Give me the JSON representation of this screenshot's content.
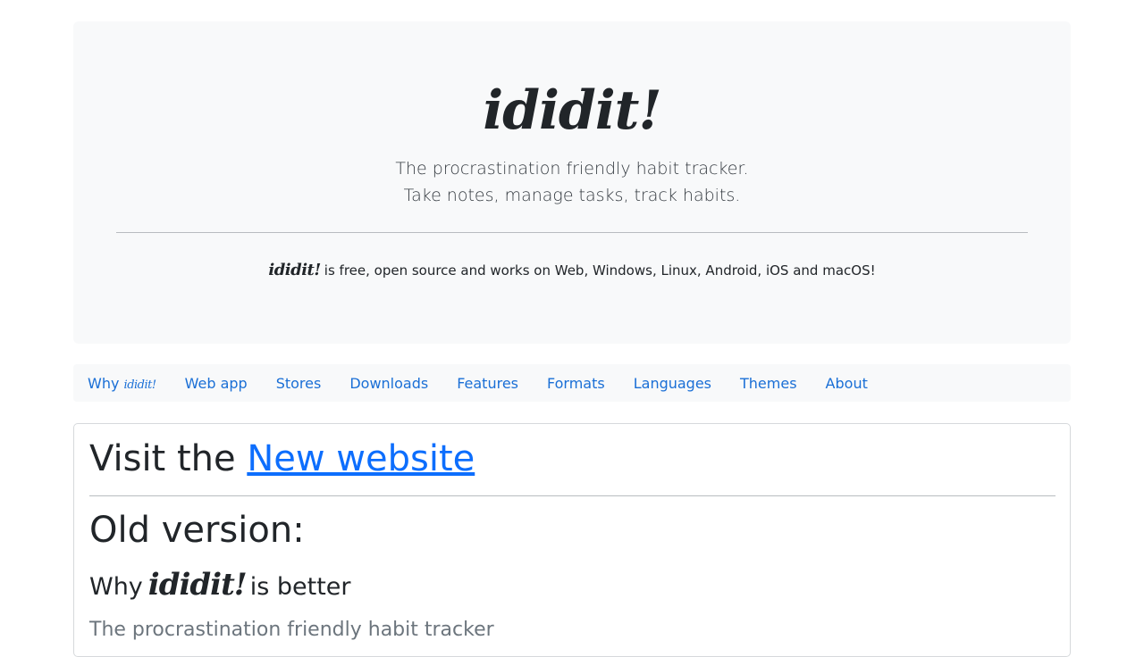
{
  "header": {
    "logo": "ididit!",
    "tagline_1": "The procrastination friendly habit tracker.",
    "tagline_2": "Take notes, manage tasks, track habits.",
    "free_logo": "ididit!",
    "free_text": "is free, open source and works on Web, Windows, Linux, Android, iOS and macOS!"
  },
  "nav": {
    "why_prefix": "Why",
    "why_logo": "ididit!",
    "items": [
      "Web app",
      "Stores",
      "Downloads",
      "Features",
      "Formats",
      "Languages",
      "Themes",
      "About"
    ]
  },
  "main": {
    "visit_prefix": "Visit the",
    "visit_link": "New website",
    "old_version": "Old version:",
    "why_prefix": "Why",
    "why_logo": "ididit!",
    "why_suffix": "is better",
    "subtitle": "The procrastination friendly habit tracker"
  },
  "colors": {
    "link": "#0d6efd",
    "jumbotron_bg": "#f8f9fa",
    "muted_text": "#6c757d"
  }
}
